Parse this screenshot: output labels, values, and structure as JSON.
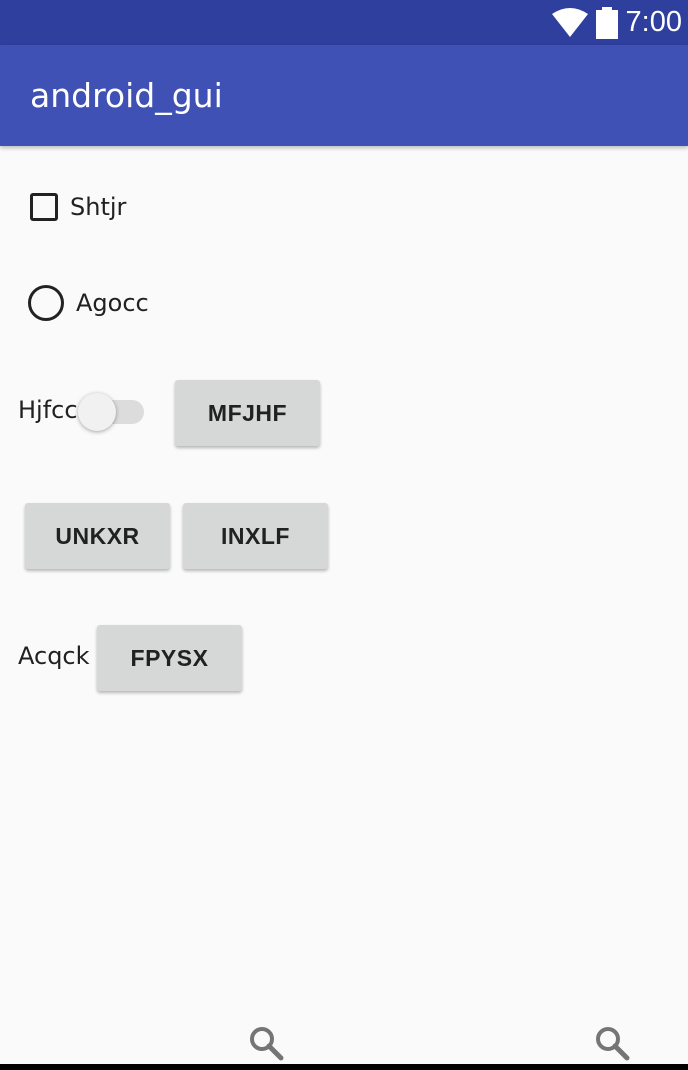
{
  "status_bar": {
    "time": "7:00",
    "icons": [
      "wifi-icon",
      "battery-icon"
    ],
    "color": "#2f3f9e"
  },
  "app_bar": {
    "title": "android_gui",
    "color": "#3f51b5"
  },
  "controls": {
    "checkbox": {
      "label": "Shtjr",
      "checked": false
    },
    "radio": {
      "label": "Agocc",
      "selected": false
    },
    "switch": {
      "label": "Hjfcc",
      "on": false
    },
    "text_label": "Acqck"
  },
  "buttons": {
    "mfjhf": "MFJHF",
    "unkxr": "UNKXR",
    "inxlf": "INXLF",
    "fpysx": "FPYSX"
  },
  "bottom_bar": {
    "icons": [
      "search-icon",
      "search-icon"
    ]
  }
}
